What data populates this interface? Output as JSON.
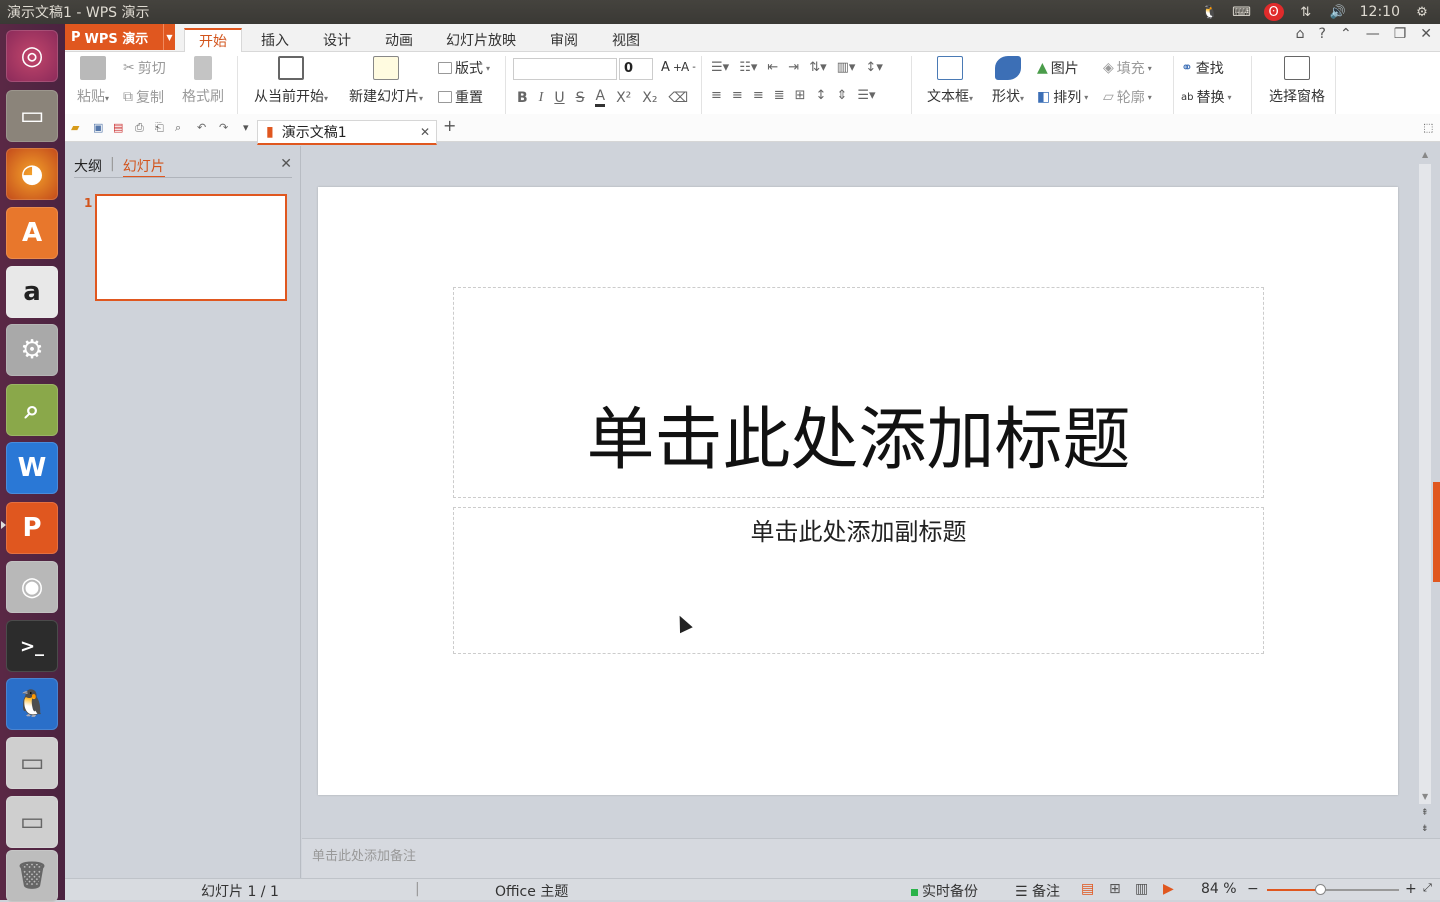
{
  "window_title": "演示文稿1 - WPS 演示",
  "tray": {
    "time": "12:10"
  },
  "app_button": "WPS 演示",
  "tabs": [
    "开始",
    "插入",
    "设计",
    "动画",
    "幻灯片放映",
    "审阅",
    "视图"
  ],
  "ribbon": {
    "paste": "粘贴",
    "cut": "剪切",
    "copy": "复制",
    "format_painter": "格式刷",
    "from_current": "从当前开始",
    "new_slide": "新建幻灯片",
    "layout": "版式",
    "reset": "重置",
    "font_size": "0",
    "textbox": "文本框",
    "shape": "形状",
    "picture": "图片",
    "arrange": "排列",
    "fill": "填充",
    "outline": "轮廓",
    "find": "查找",
    "replace": "替换",
    "selection_pane": "选择窗格"
  },
  "doc_tab": "演示文稿1",
  "panel": {
    "outline_tab": "大纲",
    "slides_tab": "幻灯片",
    "slide_number": "1"
  },
  "slide": {
    "title_placeholder": "单击此处添加标题",
    "subtitle_placeholder": "单击此处添加副标题"
  },
  "notes_placeholder": "单击此处添加备注",
  "status": {
    "slide_counter": "幻灯片 1 / 1",
    "theme": "Office 主题",
    "backup": "实时备份",
    "notes": "备注",
    "zoom": "84 %"
  },
  "colors": {
    "accent": "#e0571f",
    "launcher": "#4b2340"
  }
}
